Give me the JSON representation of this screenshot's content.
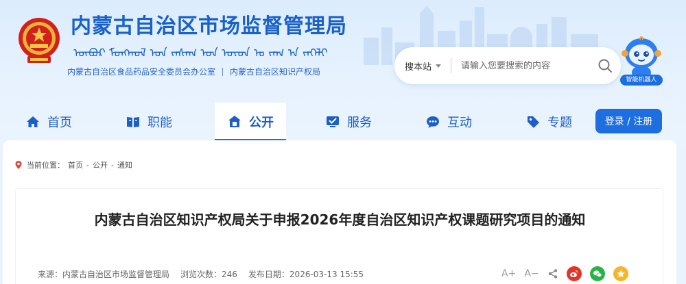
{
  "header": {
    "site_title": "内蒙古自治区市场监督管理局",
    "mongol_script": "ᠥᠪᠦᠷ ᠮᠣᠩᠭᠣᠯ ᠤᠨ ᠵᠠᠰᠠᠭ ᠤᠨ ᠣᠷᠣᠨ ᠤ ᠵᠠᠬ ᠠ ᠵᠡᠭᠡᠯᠢ",
    "sub_links": [
      "内蒙古自治区食品药品安全委员会办公室",
      "内蒙古自治区知识产权局"
    ],
    "search": {
      "scope": "搜本站",
      "placeholder": "请输入您要搜索的内容"
    },
    "robot_label": "智能机器人",
    "brand_color": "#1961c9",
    "accent_color": "#1d6fe0"
  },
  "nav": {
    "items": [
      {
        "label": "首页",
        "icon": "home-icon"
      },
      {
        "label": "职能",
        "icon": "book-icon"
      },
      {
        "label": "公开",
        "icon": "public-icon",
        "active": true
      },
      {
        "label": "服务",
        "icon": "service-icon"
      },
      {
        "label": "互动",
        "icon": "chat-icon"
      },
      {
        "label": "专题",
        "icon": "tag-icon"
      }
    ],
    "login_label": "登录 / 注册"
  },
  "breadcrumb": {
    "prefix": "当前位置：",
    "items": [
      "首页",
      "公开",
      "通知"
    ],
    "separator": "-"
  },
  "article": {
    "title": "内蒙古自治区知识产权局关于申报2026年度自治区知识产权课题研究项目的通知",
    "meta": {
      "source": "来源：内蒙古自治区市场监督管理局",
      "views": "浏览次数：246",
      "date": "发布日期：2026-03-13 15:55"
    },
    "font_increase": "A+",
    "font_decrease": "A−",
    "share_targets": [
      "weibo-icon",
      "wechat-icon",
      "qzone-icon"
    ]
  }
}
